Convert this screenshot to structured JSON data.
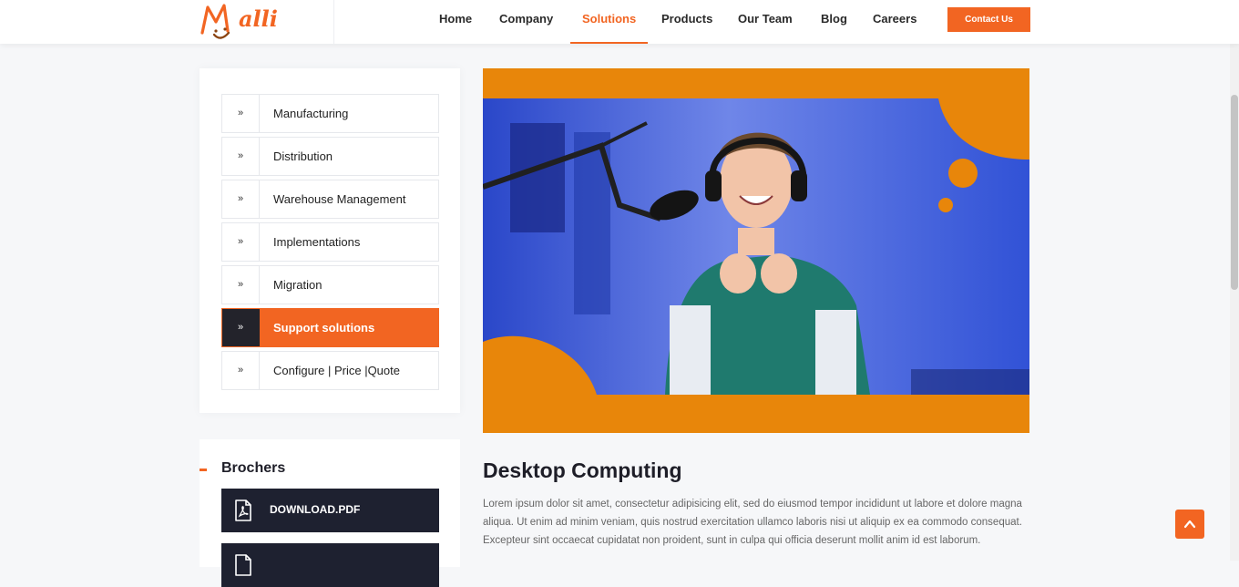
{
  "brand": {
    "logo_text": "alli"
  },
  "nav": {
    "items": [
      {
        "label": "Home"
      },
      {
        "label": "Company"
      },
      {
        "label": "Solutions",
        "active": true
      },
      {
        "label": "Products"
      },
      {
        "label": "Our Team"
      },
      {
        "label": "Blog"
      },
      {
        "label": "Careers"
      }
    ],
    "contact_label": "Contact Us"
  },
  "sidebar": {
    "items": [
      {
        "label": "Manufacturing",
        "icon": "double-chevron-right-icon"
      },
      {
        "label": "Distribution",
        "icon": "double-chevron-right-icon"
      },
      {
        "label": "Warehouse Management",
        "icon": "double-chevron-right-icon"
      },
      {
        "label": "Implementations",
        "icon": "double-chevron-right-icon"
      },
      {
        "label": "Migration",
        "icon": "double-chevron-right-icon"
      },
      {
        "label": "Support solutions",
        "icon": "double-chevron-right-icon",
        "active": true
      },
      {
        "label": "Configure | Price |Quote",
        "icon": "double-chevron-right-icon"
      }
    ]
  },
  "brochures": {
    "title": "Brochers",
    "downloads": [
      {
        "label": "DOWNLOAD.PDF",
        "icon": "pdf-file-icon"
      },
      {
        "label": "",
        "icon": "file-icon"
      }
    ]
  },
  "main": {
    "title": "Desktop Computing",
    "body": "Lorem ipsum dolor sit amet, consectetur adipisicing elit, sed do eiusmod tempor incididunt ut labore et dolore magna aliqua. Ut enim ad minim veniam, quis nostrud exercitation ullamco laboris nisi ut aliquip ex ea commodo consequat. Excepteur sint occaecat cupidatat non proident, sunt in culpa qui officia deserunt mollit anim id est laborum."
  },
  "colors": {
    "accent": "#f26522",
    "dark": "#1e2130",
    "hero_frame": "#e8860a"
  },
  "back_to_top_icon": "chevron-up-icon"
}
